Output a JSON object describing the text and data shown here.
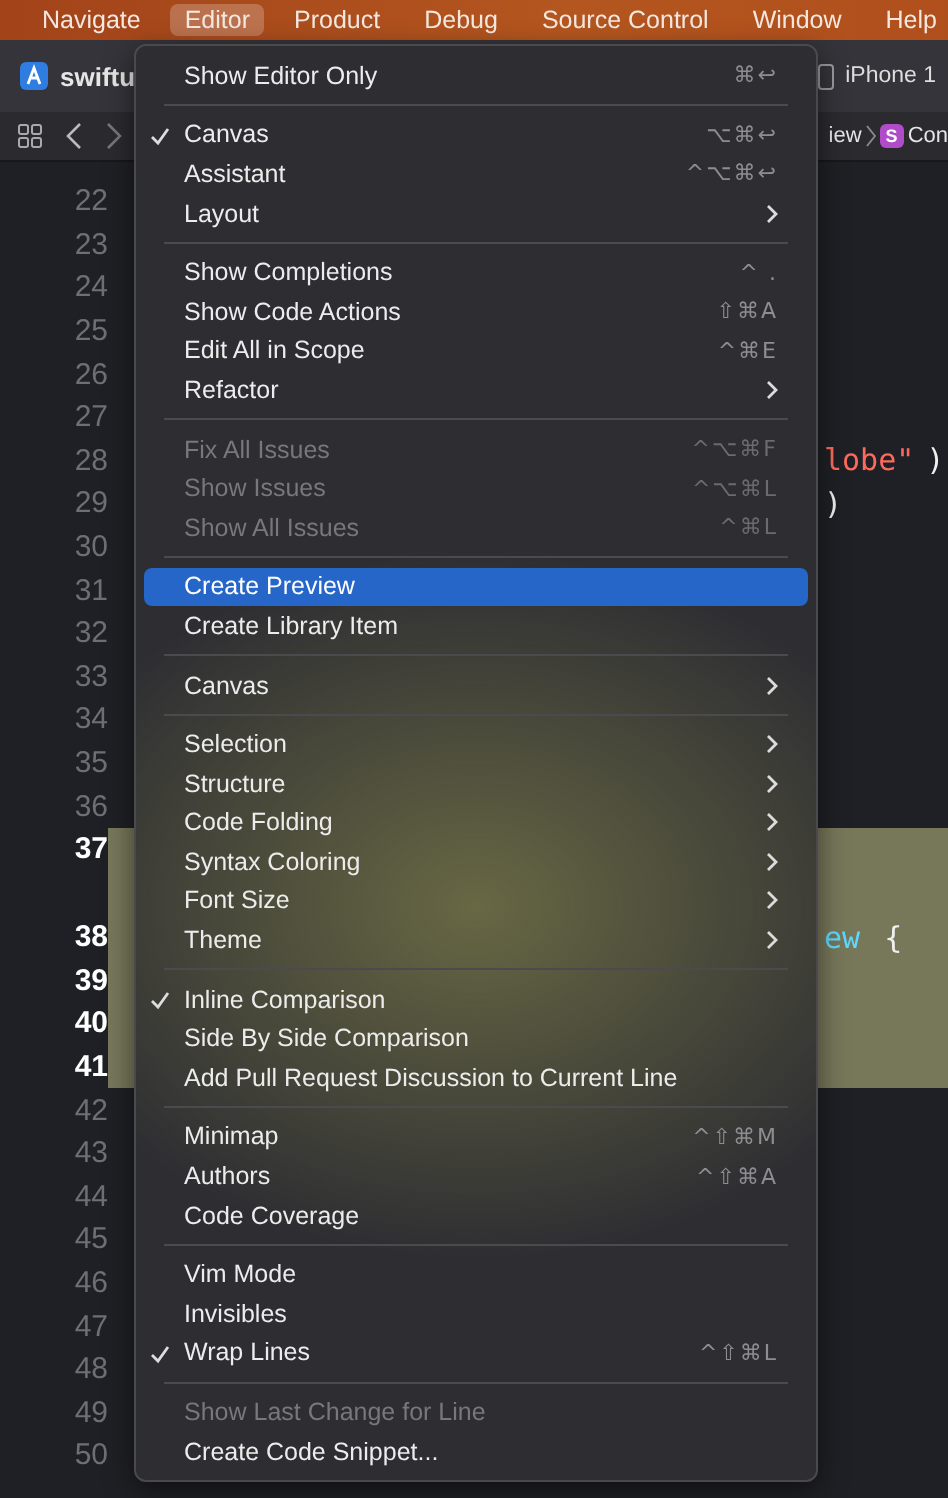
{
  "menubar": [
    {
      "label": "Navigate",
      "selected": false
    },
    {
      "label": "Editor",
      "selected": true
    },
    {
      "label": "Product",
      "selected": false
    },
    {
      "label": "Debug",
      "selected": false
    },
    {
      "label": "Source Control",
      "selected": false
    },
    {
      "label": "Window",
      "selected": false
    },
    {
      "label": "Help",
      "selected": false
    }
  ],
  "toolbar": {
    "project": "swiftu",
    "device": "iPhone 1"
  },
  "breadcrumb": {
    "item": "iew",
    "badge": "S",
    "symbol": "Con"
  },
  "editor_lines": [
    {
      "number": "22",
      "current": false
    },
    {
      "number": "23",
      "current": false
    },
    {
      "number": "24",
      "current": false
    },
    {
      "number": "25",
      "current": false
    },
    {
      "number": "26",
      "current": false
    },
    {
      "number": "27",
      "current": false
    },
    {
      "number": "28",
      "current": false,
      "code": [
        {
          "text": "lobe\"",
          "kind": "string"
        },
        {
          "text": ")",
          "kind": "plain"
        }
      ]
    },
    {
      "number": "29",
      "current": false,
      "code": [
        {
          "text": ")",
          "kind": "plain"
        }
      ]
    },
    {
      "number": "30",
      "current": false
    },
    {
      "number": "31",
      "current": false
    },
    {
      "number": "32",
      "current": false
    },
    {
      "number": "33",
      "current": false
    },
    {
      "number": "34",
      "current": false
    },
    {
      "number": "35",
      "current": false
    },
    {
      "number": "36",
      "current": false
    },
    {
      "number": "37",
      "current": true
    },
    {
      "number": "38",
      "current": true,
      "code": [
        {
          "text": "ew",
          "kind": "type"
        },
        {
          "text": "{",
          "kind": "plain"
        }
      ]
    },
    {
      "number": "39",
      "current": true
    },
    {
      "number": "40",
      "current": true
    },
    {
      "number": "41",
      "current": true
    },
    {
      "number": "42",
      "current": false
    },
    {
      "number": "43",
      "current": false
    },
    {
      "number": "44",
      "current": false
    },
    {
      "number": "45",
      "current": false
    },
    {
      "number": "46",
      "current": false
    },
    {
      "number": "47",
      "current": false
    },
    {
      "number": "48",
      "current": false
    },
    {
      "number": "49",
      "current": false
    },
    {
      "number": "50",
      "current": false
    }
  ],
  "menu": {
    "sections": [
      [
        {
          "label": "Show Editor Only",
          "shortcut": "⌘↩",
          "checked": false,
          "disabled": false,
          "selected": false,
          "submenu": false
        }
      ],
      [
        {
          "label": "Canvas",
          "shortcut": "⌥⌘↩",
          "checked": true,
          "disabled": false,
          "selected": false,
          "submenu": false
        },
        {
          "label": "Assistant",
          "shortcut": "^⌥⌘↩",
          "checked": false,
          "disabled": false,
          "selected": false,
          "submenu": false
        },
        {
          "label": "Layout",
          "checked": false,
          "disabled": false,
          "selected": false,
          "submenu": true
        }
      ],
      [
        {
          "label": "Show Completions",
          "shortcut": "^ .",
          "checked": false,
          "disabled": false,
          "selected": false,
          "submenu": false
        },
        {
          "label": "Show Code Actions",
          "shortcut": "⇧⌘A",
          "checked": false,
          "disabled": false,
          "selected": false,
          "submenu": false
        },
        {
          "label": "Edit All in Scope",
          "shortcut": "^⌘E",
          "checked": false,
          "disabled": false,
          "selected": false,
          "submenu": false
        },
        {
          "label": "Refactor",
          "checked": false,
          "disabled": false,
          "selected": false,
          "submenu": true
        }
      ],
      [
        {
          "label": "Fix All Issues",
          "shortcut": "^⌥⌘F",
          "checked": false,
          "disabled": true,
          "selected": false,
          "submenu": false
        },
        {
          "label": "Show Issues",
          "shortcut": "^⌥⌘L",
          "checked": false,
          "disabled": true,
          "selected": false,
          "submenu": false
        },
        {
          "label": "Show All Issues",
          "shortcut": "^⌘L",
          "checked": false,
          "disabled": true,
          "selected": false,
          "submenu": false
        }
      ],
      [
        {
          "label": "Create Preview",
          "checked": false,
          "disabled": false,
          "selected": true,
          "submenu": false
        },
        {
          "label": "Create Library Item",
          "checked": false,
          "disabled": false,
          "selected": false,
          "submenu": false
        }
      ],
      [
        {
          "label": "Canvas",
          "checked": false,
          "disabled": false,
          "selected": false,
          "submenu": true
        }
      ],
      [
        {
          "label": "Selection",
          "checked": false,
          "disabled": false,
          "selected": false,
          "submenu": true
        },
        {
          "label": "Structure",
          "checked": false,
          "disabled": false,
          "selected": false,
          "submenu": true
        },
        {
          "label": "Code Folding",
          "checked": false,
          "disabled": false,
          "selected": false,
          "submenu": true
        },
        {
          "label": "Syntax Coloring",
          "checked": false,
          "disabled": false,
          "selected": false,
          "submenu": true
        },
        {
          "label": "Font Size",
          "checked": false,
          "disabled": false,
          "selected": false,
          "submenu": true
        },
        {
          "label": "Theme",
          "checked": false,
          "disabled": false,
          "selected": false,
          "submenu": true
        }
      ],
      [
        {
          "label": "Inline Comparison",
          "checked": true,
          "disabled": false,
          "selected": false,
          "submenu": false
        },
        {
          "label": "Side By Side Comparison",
          "checked": false,
          "disabled": false,
          "selected": false,
          "submenu": false
        },
        {
          "label": "Add Pull Request Discussion to Current Line",
          "checked": false,
          "disabled": false,
          "selected": false,
          "submenu": false
        }
      ],
      [
        {
          "label": "Minimap",
          "shortcut": "^⇧⌘M",
          "checked": false,
          "disabled": false,
          "selected": false,
          "submenu": false
        },
        {
          "label": "Authors",
          "shortcut": "^⇧⌘A",
          "checked": false,
          "disabled": false,
          "selected": false,
          "submenu": false
        },
        {
          "label": "Code Coverage",
          "checked": false,
          "disabled": false,
          "selected": false,
          "submenu": false
        }
      ],
      [
        {
          "label": "Vim Mode",
          "checked": false,
          "disabled": false,
          "selected": false,
          "submenu": false
        },
        {
          "label": "Invisibles",
          "checked": false,
          "disabled": false,
          "selected": false,
          "submenu": false
        },
        {
          "label": "Wrap Lines",
          "shortcut": "^⇧⌘L",
          "checked": true,
          "disabled": false,
          "selected": false,
          "submenu": false
        }
      ],
      [
        {
          "label": "Show Last Change for Line",
          "checked": false,
          "disabled": true,
          "selected": false,
          "submenu": false
        },
        {
          "label": "Create Code Snippet...",
          "checked": false,
          "disabled": false,
          "selected": false,
          "submenu": false
        }
      ]
    ]
  }
}
